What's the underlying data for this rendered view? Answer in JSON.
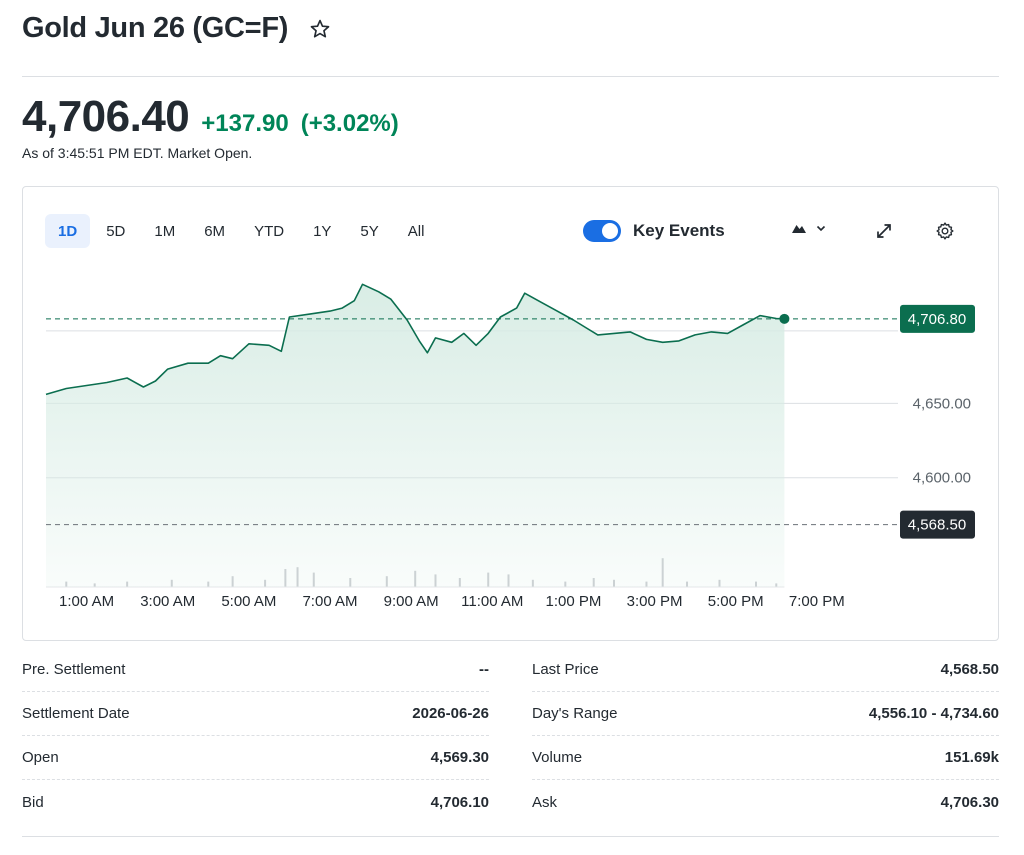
{
  "header": {
    "title": "Gold Jun 26 (GC=F)",
    "star_icon": "star-outline-icon"
  },
  "quote": {
    "price": "4,706.40",
    "change": "+137.90",
    "change_pct": "(+3.02%)",
    "as_of": "As of 3:45:51 PM EDT. Market Open.",
    "up_color": "#008558"
  },
  "chart_controls": {
    "ranges": [
      "1D",
      "5D",
      "1M",
      "6M",
      "YTD",
      "1Y",
      "5Y",
      "All"
    ],
    "active_range": "1D",
    "key_events_label": "Key Events",
    "key_events_on": true,
    "chart_type_icon": "mountain-chart-icon",
    "expand_icon": "expand-icon",
    "settings_icon": "gear-icon",
    "accent_color": "#1a6ee3"
  },
  "chart_data": {
    "type": "area",
    "x_unit": "hours",
    "xlim": [
      0,
      21
    ],
    "ylim": [
      4540,
      4745
    ],
    "x_ticks": [
      {
        "x": 1,
        "label": "1:00 AM"
      },
      {
        "x": 3,
        "label": "3:00 AM"
      },
      {
        "x": 5,
        "label": "5:00 AM"
      },
      {
        "x": 7,
        "label": "7:00 AM"
      },
      {
        "x": 9,
        "label": "9:00 AM"
      },
      {
        "x": 11,
        "label": "11:00 AM"
      },
      {
        "x": 13,
        "label": "1:00 PM"
      },
      {
        "x": 15,
        "label": "3:00 PM"
      },
      {
        "x": 17,
        "label": "5:00 PM"
      },
      {
        "x": 19,
        "label": "7:00 PM"
      }
    ],
    "y_ticks": [
      {
        "y": 4650,
        "label": "4,650.00"
      },
      {
        "y": 4600,
        "label": "4,600.00"
      }
    ],
    "current_price": {
      "y": 4706.8,
      "label": "4,706.80",
      "color": "#0b6e4f"
    },
    "previous_close": {
      "y": 4568.5,
      "label": "4,568.50",
      "color": "#232a31"
    },
    "line_color": "#0b6e4f",
    "fill_color": "#d7ece4",
    "series": [
      {
        "values": [
          [
            0.0,
            4656
          ],
          [
            0.5,
            4660
          ],
          [
            1.0,
            4662
          ],
          [
            1.5,
            4664
          ],
          [
            2.0,
            4667
          ],
          [
            2.4,
            4661
          ],
          [
            2.7,
            4665
          ],
          [
            3.0,
            4673
          ],
          [
            3.5,
            4677
          ],
          [
            4.0,
            4677
          ],
          [
            4.3,
            4682
          ],
          [
            4.6,
            4680
          ],
          [
            5.0,
            4690
          ],
          [
            5.5,
            4689
          ],
          [
            5.8,
            4685
          ],
          [
            6.0,
            4708
          ],
          [
            6.5,
            4710
          ],
          [
            7.0,
            4712
          ],
          [
            7.3,
            4714
          ],
          [
            7.6,
            4719
          ],
          [
            7.8,
            4730
          ],
          [
            8.2,
            4725
          ],
          [
            8.5,
            4720
          ],
          [
            8.9,
            4706
          ],
          [
            9.2,
            4692
          ],
          [
            9.4,
            4684
          ],
          [
            9.6,
            4694
          ],
          [
            10.0,
            4691
          ],
          [
            10.3,
            4697
          ],
          [
            10.6,
            4689
          ],
          [
            10.9,
            4697
          ],
          [
            11.2,
            4708
          ],
          [
            11.6,
            4714
          ],
          [
            11.8,
            4724
          ],
          [
            12.2,
            4718
          ],
          [
            12.6,
            4712
          ],
          [
            13.0,
            4706
          ],
          [
            13.3,
            4701
          ],
          [
            13.6,
            4696
          ],
          [
            14.0,
            4697
          ],
          [
            14.4,
            4698
          ],
          [
            14.8,
            4693
          ],
          [
            15.2,
            4691
          ],
          [
            15.6,
            4692
          ],
          [
            16.0,
            4696
          ],
          [
            16.4,
            4698
          ],
          [
            16.8,
            4697
          ],
          [
            17.2,
            4703
          ],
          [
            17.6,
            4709
          ],
          [
            18.0,
            4707
          ],
          [
            18.2,
            4706.8
          ]
        ]
      }
    ],
    "volume": [
      {
        "x": 0.5,
        "v": 0.3
      },
      {
        "x": 1.2,
        "v": 0.2
      },
      {
        "x": 2.0,
        "v": 0.3
      },
      {
        "x": 3.1,
        "v": 0.4
      },
      {
        "x": 4.0,
        "v": 0.3
      },
      {
        "x": 4.6,
        "v": 0.6
      },
      {
        "x": 5.4,
        "v": 0.4
      },
      {
        "x": 5.9,
        "v": 1.0
      },
      {
        "x": 6.2,
        "v": 1.1
      },
      {
        "x": 6.6,
        "v": 0.8
      },
      {
        "x": 7.5,
        "v": 0.5
      },
      {
        "x": 8.4,
        "v": 0.6
      },
      {
        "x": 9.1,
        "v": 0.9
      },
      {
        "x": 9.6,
        "v": 0.7
      },
      {
        "x": 10.2,
        "v": 0.5
      },
      {
        "x": 10.9,
        "v": 0.8
      },
      {
        "x": 11.4,
        "v": 0.7
      },
      {
        "x": 12.0,
        "v": 0.4
      },
      {
        "x": 12.8,
        "v": 0.3
      },
      {
        "x": 13.5,
        "v": 0.5
      },
      {
        "x": 14.0,
        "v": 0.4
      },
      {
        "x": 14.8,
        "v": 0.3
      },
      {
        "x": 15.2,
        "v": 1.6
      },
      {
        "x": 15.8,
        "v": 0.3
      },
      {
        "x": 16.6,
        "v": 0.4
      },
      {
        "x": 17.5,
        "v": 0.3
      },
      {
        "x": 18.0,
        "v": 0.2
      }
    ]
  },
  "stats": {
    "left": [
      {
        "label": "Pre. Settlement",
        "value": "--"
      },
      {
        "label": "Settlement Date",
        "value": "2026-06-26"
      },
      {
        "label": "Open",
        "value": "4,569.30"
      },
      {
        "label": "Bid",
        "value": "4,706.10"
      }
    ],
    "right": [
      {
        "label": "Last Price",
        "value": "4,568.50"
      },
      {
        "label": "Day's Range",
        "value": "4,556.10 - 4,734.60"
      },
      {
        "label": "Volume",
        "value": "151.69k"
      },
      {
        "label": "Ask",
        "value": "4,706.30"
      }
    ]
  }
}
